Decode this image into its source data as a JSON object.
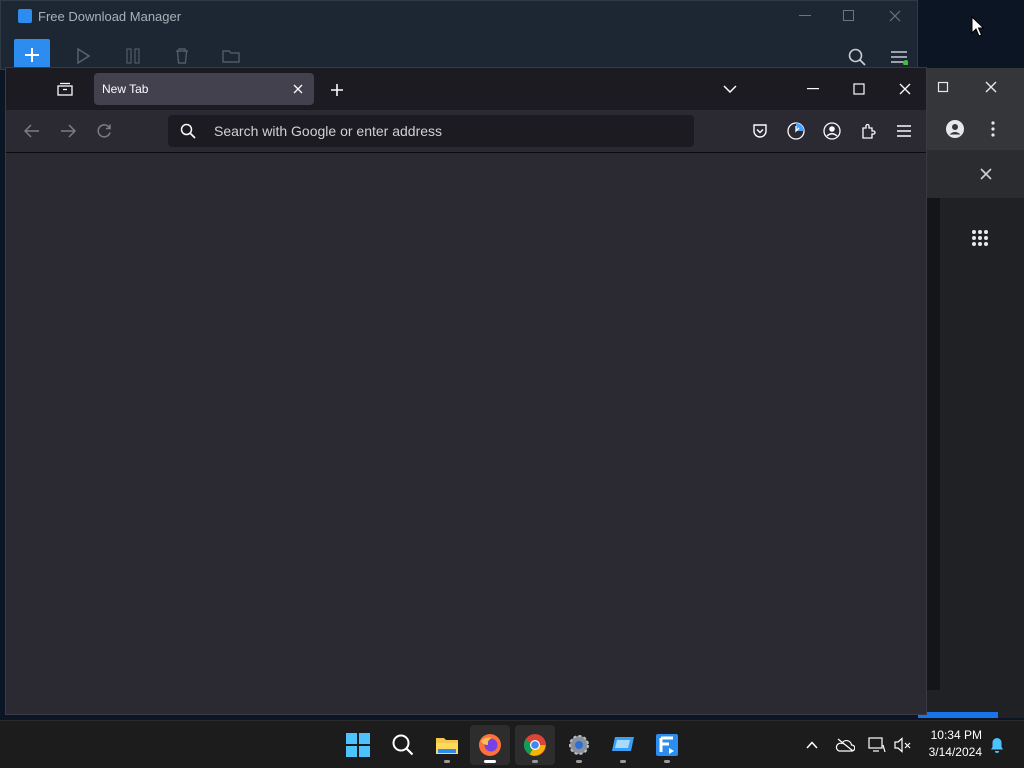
{
  "fdm_window": {
    "title": "Free Download Manager",
    "icons": [
      "add-icon",
      "play-icon",
      "pause-icon",
      "delete-icon",
      "folder-icon",
      "search-icon",
      "menu-icon"
    ]
  },
  "firefox": {
    "tab": {
      "title": "New Tab"
    },
    "urlbar": {
      "placeholder": "Search with Google or enter address"
    },
    "icons": [
      "firefox-view-icon",
      "close-tab-icon",
      "new-tab-icon",
      "list-tabs-icon",
      "minimize-icon",
      "maximize-icon",
      "close-window-icon",
      "back-icon",
      "forward-icon",
      "reload-icon",
      "search-icon",
      "pocket-icon",
      "update-icon",
      "account-icon",
      "extensions-icon",
      "menu-icon"
    ]
  },
  "taskbar": {
    "time": "10:34 PM",
    "date": "3/14/2024",
    "apps": [
      "start",
      "search",
      "file-explorer",
      "firefox",
      "chrome",
      "settings",
      "remote-desktop",
      "free-download-manager"
    ],
    "tray_icons": [
      "chevron-up-icon",
      "onedrive-icon",
      "network-icon",
      "volume-muted-icon",
      "notifications-icon"
    ]
  },
  "colors": {
    "accent": "#2d8cf0",
    "firefox_bg": "#2b2a33",
    "taskbar_bg": "#1c1c1c"
  }
}
